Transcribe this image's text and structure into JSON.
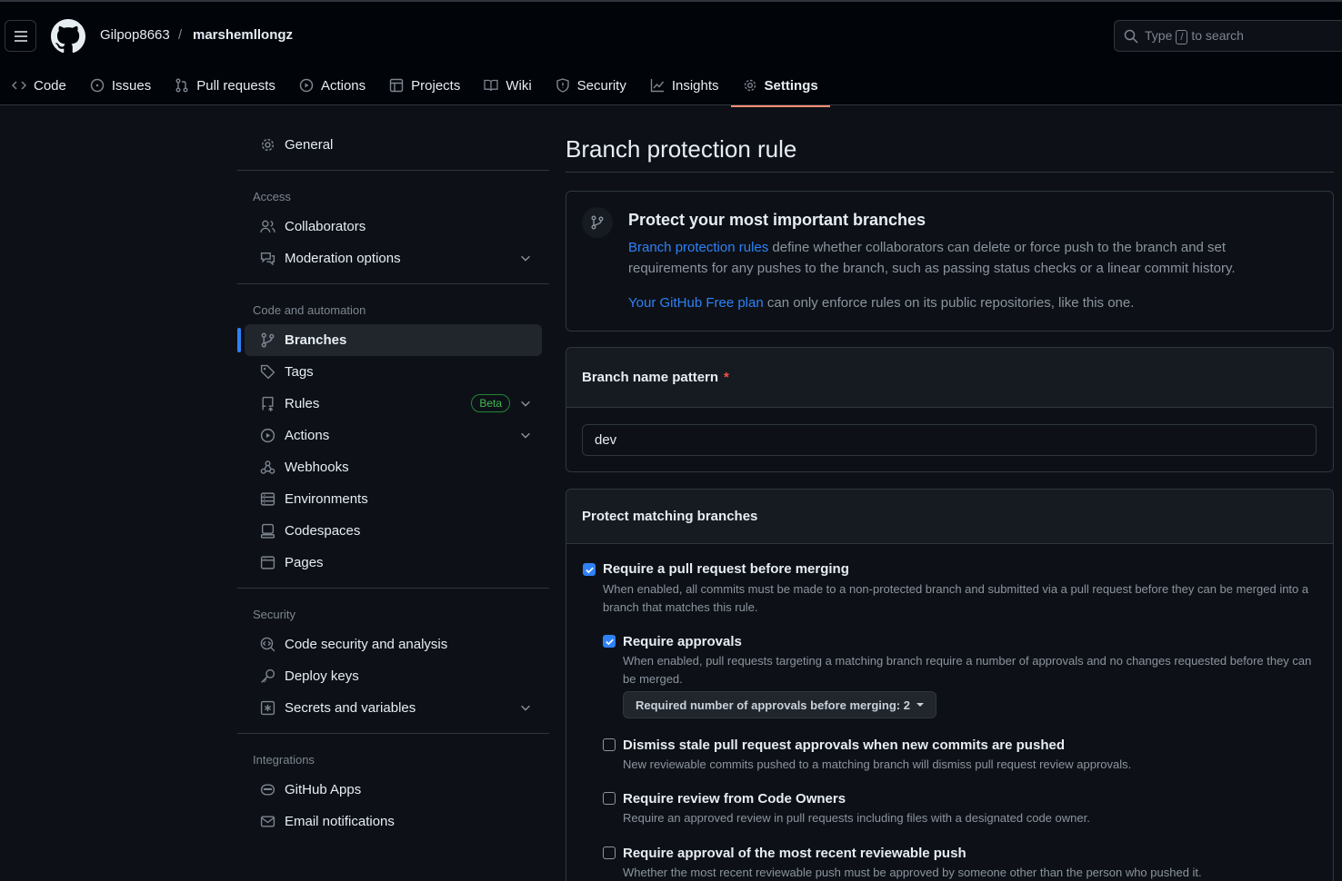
{
  "header": {
    "owner": "Gilpop8663",
    "separator": "/",
    "repo": "marshemllongz",
    "search_prefix": "Type",
    "search_key": "/",
    "search_suffix": "to search"
  },
  "tabs": [
    {
      "label": "Code",
      "icon": "code-icon"
    },
    {
      "label": "Issues",
      "icon": "issue-icon"
    },
    {
      "label": "Pull requests",
      "icon": "pull-request-icon"
    },
    {
      "label": "Actions",
      "icon": "play-icon"
    },
    {
      "label": "Projects",
      "icon": "table-icon"
    },
    {
      "label": "Wiki",
      "icon": "book-icon"
    },
    {
      "label": "Security",
      "icon": "shield-icon"
    },
    {
      "label": "Insights",
      "icon": "graph-icon"
    },
    {
      "label": "Settings",
      "icon": "gear-icon",
      "active": true
    }
  ],
  "sidebar": {
    "general": "General",
    "access_heading": "Access",
    "collaborators": "Collaborators",
    "moderation": "Moderation options",
    "code_heading": "Code and automation",
    "branches": "Branches",
    "tags": "Tags",
    "rules": "Rules",
    "rules_badge": "Beta",
    "actions": "Actions",
    "webhooks": "Webhooks",
    "environments": "Environments",
    "codespaces": "Codespaces",
    "pages": "Pages",
    "security_heading": "Security",
    "code_security": "Code security and analysis",
    "deploy_keys": "Deploy keys",
    "secrets": "Secrets and variables",
    "integrations_heading": "Integrations",
    "github_apps": "GitHub Apps",
    "email_notifications": "Email notifications"
  },
  "main": {
    "title": "Branch protection rule",
    "info_title": "Protect your most important branches",
    "info_link": "Branch protection rules",
    "info_text": " define whether collaborators can delete or force push to the branch and set requirements for any pushes to the branch, such as passing status checks or a linear commit history.",
    "plan_link": "Your GitHub Free plan",
    "plan_text": " can only enforce rules on its public repositories, like this one.",
    "pattern_label": "Branch name pattern",
    "pattern_required": "*",
    "pattern_value": "dev",
    "protect_heading": "Protect matching branches",
    "options": [
      {
        "label": "Require a pull request before merging",
        "desc": "When enabled, all commits must be made to a non-protected branch and submitted via a pull request before they can be merged into a branch that matches this rule.",
        "checked": true
      },
      {
        "label": "Require approvals",
        "desc": "When enabled, pull requests targeting a matching branch require a number of approvals and no changes requested before they can be merged.",
        "checked": true
      },
      {
        "label": "Dismiss stale pull request approvals when new commits are pushed",
        "desc": "New reviewable commits pushed to a matching branch will dismiss pull request review approvals.",
        "checked": false
      },
      {
        "label": "Require review from Code Owners",
        "desc": "Require an approved review in pull requests including files with a designated code owner.",
        "checked": false
      },
      {
        "label": "Require approval of the most recent reviewable push",
        "desc": "Whether the most recent reviewable push must be approved by someone other than the person who pushed it.",
        "checked": false
      }
    ],
    "approvals_button": "Required number of approvals before merging: 2"
  },
  "colors": {
    "background": "#0d1117",
    "accent": "#2f81f7",
    "active_tab_underline": "#fd8c73",
    "beta_badge": "#3fb950",
    "required": "#f85149"
  }
}
